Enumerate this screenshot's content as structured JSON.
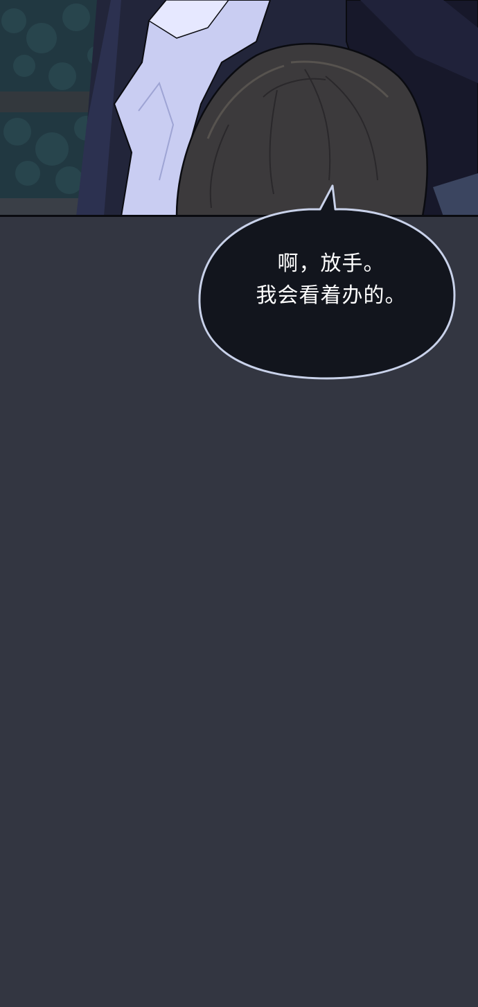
{
  "panel": {
    "scene": "illustration",
    "colors": {
      "background": "#333641",
      "bubble_fill": "#12151d",
      "bubble_outline": "#c9d2ea",
      "text": "#ffffff"
    }
  },
  "speech_bubble": {
    "line1": "啊，放手。",
    "line2": "我会看着办的。"
  }
}
